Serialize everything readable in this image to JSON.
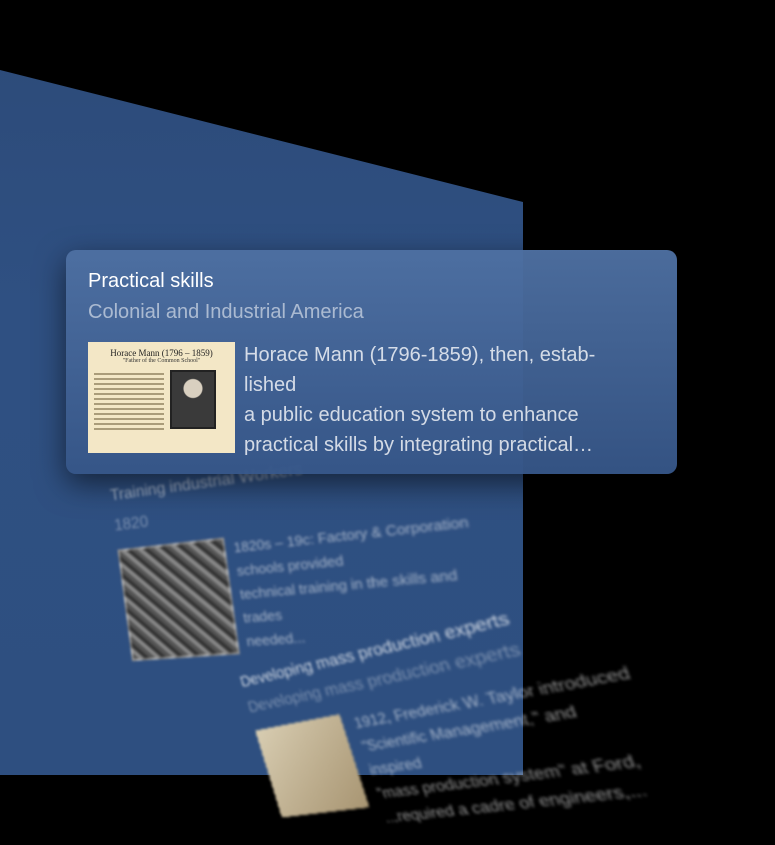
{
  "card": {
    "title": "Practical skills",
    "subtitle": "Colonial and Industrial America",
    "thumbnail": {
      "heading": "Horace Mann (1796 – 1859)",
      "quote": "\"Father of the Common School\""
    },
    "body_lines": [
      "Horace Mann (1796-1859), then, estab-",
      "lished",
      "a public education system to enhance",
      "practical skills by integrating practical…"
    ]
  },
  "background_card": {
    "title": "Training industrial Workers",
    "year": "1820",
    "body_lines": [
      "1820s – 19c: Factory & Corporation",
      "schools provided",
      "technical training in the skills and trades",
      "needed..."
    ],
    "sub_card": {
      "title": "Developing mass production experts",
      "subtitle": "Developing mass production experts",
      "body_lines": [
        "1912, Frederick W. Taylor introduced",
        "\"Scientific Management,\" and inspired",
        "\"mass production system\" at Ford,",
        "...required a cadre of engineers,..."
      ]
    }
  }
}
